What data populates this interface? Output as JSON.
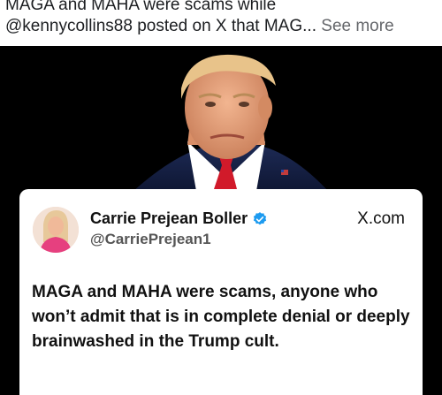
{
  "post": {
    "caption_line1": "MAGA and MAHA were scams while",
    "caption_line2": "@kennycollins88 posted on X that MAG",
    "ellipsis": "...",
    "see_more_label": "See more"
  },
  "embedded_tweet": {
    "author_name": "Carrie Prejean Boller",
    "handle": "@CarriePrejean1",
    "site_label": "X.com",
    "text": "MAGA and MAHA were scams, anyone who won’t admit that is in complete denial or deeply brainwashed in the Trump cult.",
    "verified_color": "#1d9bf0"
  },
  "icons": {
    "verified": "verified-badge-icon"
  }
}
